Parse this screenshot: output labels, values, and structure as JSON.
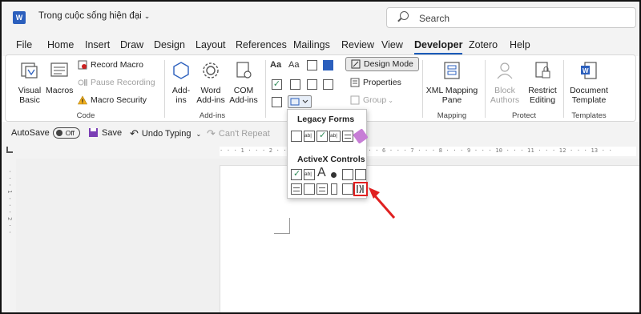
{
  "titlebar": {
    "app_icon": "word-logo-icon",
    "logo_letter": "W",
    "doc_title": "Trong cuộc sống hiện đại",
    "search_placeholder": "Search"
  },
  "tabs": [
    {
      "label": "File"
    },
    {
      "label": "Home"
    },
    {
      "label": "Insert"
    },
    {
      "label": "Draw"
    },
    {
      "label": "Design"
    },
    {
      "label": "Layout"
    },
    {
      "label": "References"
    },
    {
      "label": "Mailings"
    },
    {
      "label": "Review"
    },
    {
      "label": "View"
    },
    {
      "label": "Developer"
    },
    {
      "label": "Zotero"
    },
    {
      "label": "Help"
    }
  ],
  "active_tab": "Developer",
  "ribbon": {
    "code": {
      "label": "Code",
      "visual_basic": "Visual Basic",
      "macros": "Macros",
      "record_macro": "Record Macro",
      "pause_recording": "Pause Recording",
      "macro_security": "Macro Security"
    },
    "addins": {
      "label": "Add-ins",
      "add_ins": "Add-ins",
      "word_add_ins": "Word Add-ins",
      "com_add_ins": "COM Add-ins"
    },
    "controls": {
      "design_mode": "Design Mode",
      "properties": "Properties",
      "group": "Group"
    },
    "mapping": {
      "label": "Mapping",
      "xml_mapping_pane": "XML Mapping Pane"
    },
    "protect": {
      "label": "Protect",
      "block_authors": "Block Authors",
      "restrict_editing": "Restrict Editing"
    },
    "templates": {
      "label": "Templates",
      "document_template": "Document Template"
    }
  },
  "qat": {
    "autosave": "AutoSave",
    "toggle": "Off",
    "save": "Save",
    "undo": "Undo Typing",
    "repeat": "Can't Repeat"
  },
  "ruler": {
    "marks": "· · · 1 · · · 2 · · · 3 · · · 4 · · · 5 · · · 6 · · · 7 · · · 8 · · · 9 · · · 10 · · · 11 · · · 12 · · · 13 · ·",
    "vmarks": "· · · 1 · · · 2 · ·"
  },
  "dropdown": {
    "legacy_forms": "Legacy Forms",
    "activex_controls": "ActiveX Controls"
  },
  "colors": {
    "accent": "#1a5bb8",
    "highlight": "#e02020",
    "word_blue": "#2b5fbd"
  }
}
